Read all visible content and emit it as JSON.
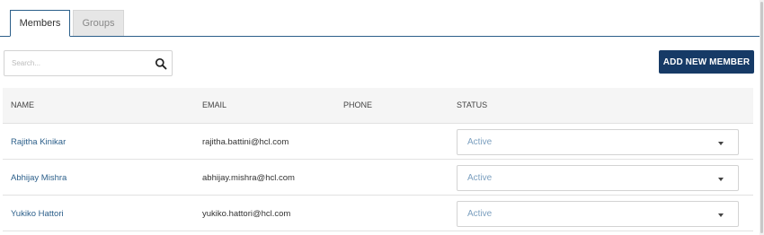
{
  "tabs": [
    {
      "label": "Members",
      "active": true
    },
    {
      "label": "Groups",
      "active": false
    }
  ],
  "search": {
    "placeholder": "Search..."
  },
  "actions": {
    "add_member_label": "ADD NEW MEMBER"
  },
  "table": {
    "headers": {
      "name": "NAME",
      "email": "EMAIL",
      "phone": "PHONE",
      "status": "STATUS"
    },
    "rows": [
      {
        "name": "Rajitha Kinikar",
        "email": "rajitha.battini@hcl.com",
        "phone": "",
        "status": "Active"
      },
      {
        "name": "Abhijay Mishra",
        "email": "abhijay.mishra@hcl.com",
        "phone": "",
        "status": "Active"
      },
      {
        "name": "Yukiko Hattori",
        "email": "yukiko.hattori@hcl.com",
        "phone": "",
        "status": "Active"
      }
    ]
  },
  "colors": {
    "primary": "#163a66",
    "link": "#2c5f8a",
    "status_text": "#7b9fbf"
  },
  "icons": {
    "search": "search-icon",
    "dropdown": "chevron-down-icon"
  }
}
